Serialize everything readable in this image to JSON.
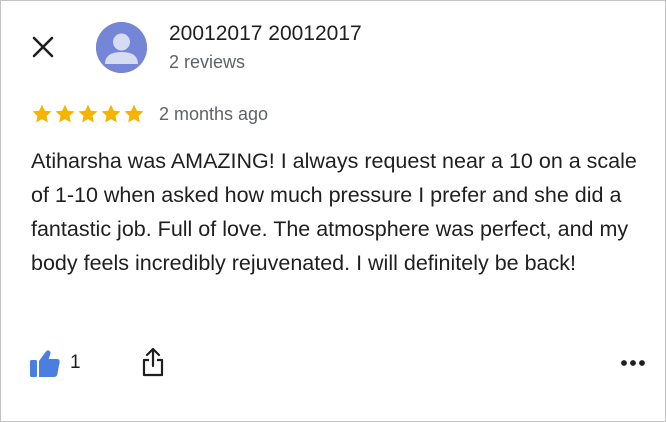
{
  "reviewer": {
    "name": "20012017 20012017",
    "reviews_count": "2 reviews",
    "avatar_color": "#7686d6"
  },
  "review": {
    "rating": 5,
    "rating_max": 5,
    "star_color": "#f4b400",
    "date": "2 months ago",
    "text": "Atiharsha was AMAZING! I always request near a 10 on a scale of 1-10 when asked how much pressure I prefer and she did a fantastic job. Full of love. The atmosphere was perfect, and my body feels incredibly rejuvenated. I will definitely be back!"
  },
  "actions": {
    "like_count": "1",
    "like_icon": "thumbs-up-icon",
    "like_color": "#4a7fe0",
    "share_icon": "share-icon",
    "more_icon": "more-horizontal-icon",
    "close_icon": "close-icon"
  }
}
